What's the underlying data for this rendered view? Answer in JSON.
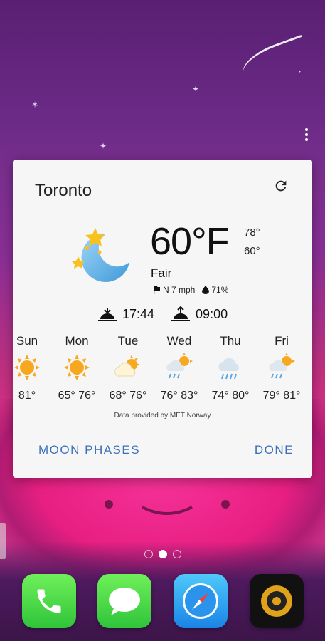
{
  "widget": {
    "city": "Toronto",
    "temperature": "60°F",
    "high": "78°",
    "low": "60°",
    "condition": "Fair",
    "wind": "N 7 mph",
    "humidity": "71%",
    "sunset": "17:44",
    "sunrise": "09:00",
    "credit": "Data provided by MET Norway",
    "buttons": {
      "moon_phases": "MOON PHASES",
      "done": "DONE"
    },
    "forecast": [
      {
        "day": "Sun",
        "temps": "81°",
        "icon": "sun-icon"
      },
      {
        "day": "Mon",
        "temps": "65° 76°",
        "icon": "sun-icon"
      },
      {
        "day": "Tue",
        "temps": "68° 76°",
        "icon": "partly-cloudy-icon"
      },
      {
        "day": "Wed",
        "temps": "76° 83°",
        "icon": "sun-rain-icon"
      },
      {
        "day": "Thu",
        "temps": "74° 80°",
        "icon": "rain-cloud-icon"
      },
      {
        "day": "Fri",
        "temps": "79° 81°",
        "icon": "sun-rain-icon"
      }
    ]
  },
  "dock": {
    "apps": [
      {
        "name": "phone-app",
        "icon": "phone-icon"
      },
      {
        "name": "messages-app",
        "icon": "speech-bubble-icon"
      },
      {
        "name": "safari-app",
        "icon": "compass-icon"
      },
      {
        "name": "music-app",
        "icon": "speaker-icon"
      }
    ]
  },
  "home": {
    "pages": 3,
    "active_page": 2
  },
  "colors": {
    "accent": "#3b6fb8",
    "card": "#f6f6f6"
  }
}
